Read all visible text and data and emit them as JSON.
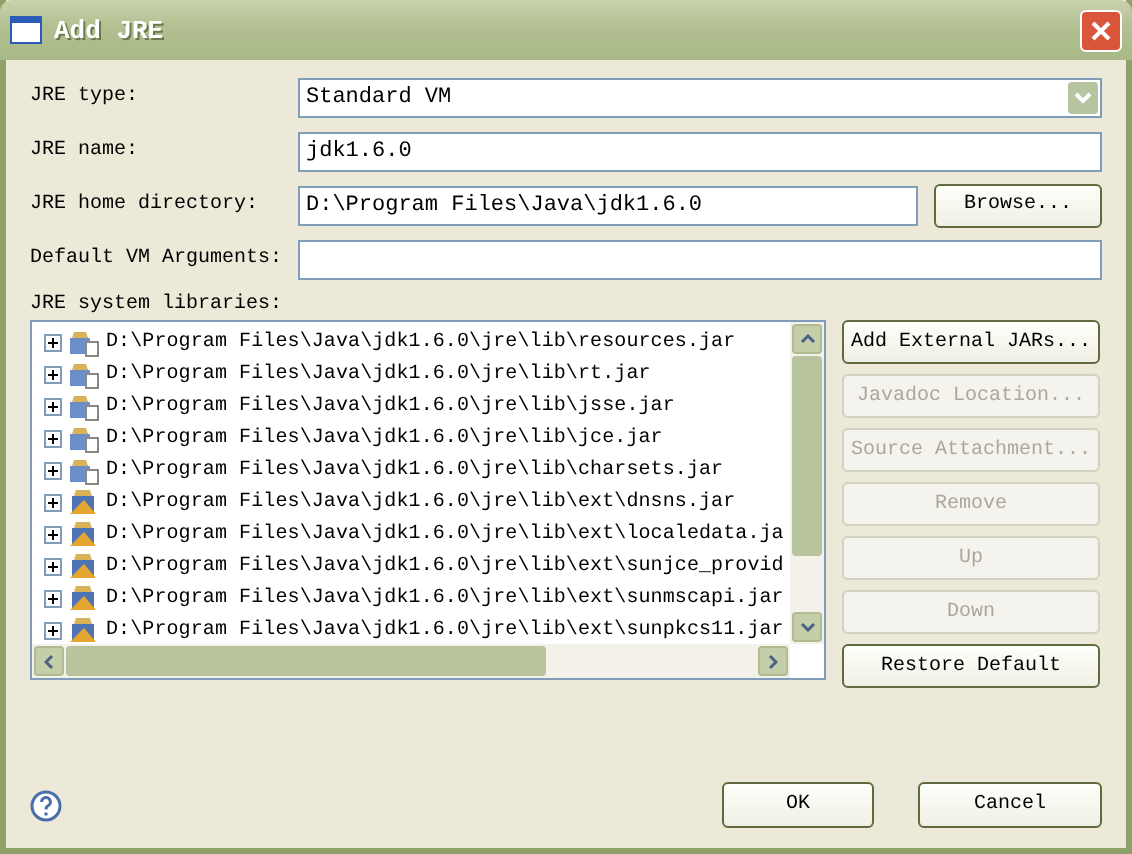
{
  "window": {
    "title": "Add JRE"
  },
  "fields": [
    {
      "kind": "combo",
      "label": "JRE type:",
      "value": "Standard VM"
    },
    {
      "kind": "text",
      "label": "JRE name:",
      "value": "jdk1.6.0"
    },
    {
      "kind": "browse",
      "label": "JRE home directory:",
      "value": "D:\\Program Files\\Java\\jdk1.6.0",
      "button": "Browse..."
    },
    {
      "kind": "text",
      "label": "Default VM Arguments:"
    }
  ],
  "libraries": {
    "label": "JRE system libraries:",
    "items": [
      {
        "kind": "jar",
        "path": "D:\\Program Files\\Java\\jdk1.6.0\\jre\\lib\\resources.jar"
      },
      {
        "kind": "jar",
        "path": "D:\\Program Files\\Java\\jdk1.6.0\\jre\\lib\\rt.jar"
      },
      {
        "kind": "jar",
        "path": "D:\\Program Files\\Java\\jdk1.6.0\\jre\\lib\\jsse.jar"
      },
      {
        "kind": "jar",
        "path": "D:\\Program Files\\Java\\jdk1.6.0\\jre\\lib\\jce.jar"
      },
      {
        "kind": "jar",
        "path": "D:\\Program Files\\Java\\jdk1.6.0\\jre\\lib\\charsets.jar"
      },
      {
        "kind": "ext",
        "path": "D:\\Program Files\\Java\\jdk1.6.0\\jre\\lib\\ext\\dnsns.jar"
      },
      {
        "kind": "ext",
        "path": "D:\\Program Files\\Java\\jdk1.6.0\\jre\\lib\\ext\\localedata.ja"
      },
      {
        "kind": "ext",
        "path": "D:\\Program Files\\Java\\jdk1.6.0\\jre\\lib\\ext\\sunjce_provid"
      },
      {
        "kind": "ext",
        "path": "D:\\Program Files\\Java\\jdk1.6.0\\jre\\lib\\ext\\sunmscapi.jar"
      },
      {
        "kind": "ext",
        "path": "D:\\Program Files\\Java\\jdk1.6.0\\jre\\lib\\ext\\sunpkcs11.jar"
      }
    ],
    "buttons": [
      {
        "label": "Add External JARs...",
        "disabled": false
      },
      {
        "label": "Javadoc Location...",
        "disabled": true
      },
      {
        "label": "Source Attachment...",
        "disabled": true
      },
      {
        "label": "Remove",
        "disabled": true
      },
      {
        "label": "Up",
        "disabled": true
      },
      {
        "label": "Down",
        "disabled": true
      },
      {
        "label": "Restore Default",
        "disabled": false
      }
    ]
  },
  "footer": {
    "buttons": [
      "OK",
      "Cancel"
    ]
  }
}
